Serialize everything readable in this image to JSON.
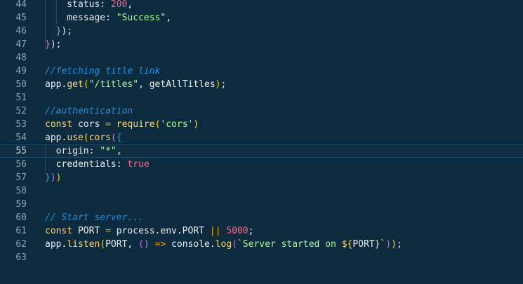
{
  "editor": {
    "lines": [
      {
        "number": "44",
        "tokens": [
          {
            "t": "    status: ",
            "c": "t-plain"
          },
          {
            "t": "200",
            "c": "t-num"
          },
          {
            "t": ",",
            "c": "t-plain"
          }
        ]
      },
      {
        "number": "45",
        "tokens": [
          {
            "t": "    message: ",
            "c": "t-plain"
          },
          {
            "t": "\"Success\"",
            "c": "t-str"
          },
          {
            "t": ",",
            "c": "t-plain"
          }
        ]
      },
      {
        "number": "46",
        "tokens": [
          {
            "t": "  ",
            "c": "t-plain"
          },
          {
            "t": "}",
            "c": "t-b2"
          },
          {
            "t": ");",
            "c": "t-plain"
          }
        ]
      },
      {
        "number": "47",
        "tokens": [
          {
            "t": "}",
            "c": "t-b2"
          },
          {
            "t": ");",
            "c": "t-plain"
          }
        ]
      },
      {
        "number": "48",
        "tokens": []
      },
      {
        "number": "49",
        "tokens": [
          {
            "t": "//fetching title link",
            "c": "t-cmt"
          }
        ]
      },
      {
        "number": "50",
        "tokens": [
          {
            "t": "app.",
            "c": "t-plain"
          },
          {
            "t": "get",
            "c": "t-fn"
          },
          {
            "t": "(",
            "c": "t-b1"
          },
          {
            "t": "\"/titles\"",
            "c": "t-str"
          },
          {
            "t": ", getAllTitles",
            "c": "t-plain"
          },
          {
            "t": ")",
            "c": "t-b1"
          },
          {
            "t": ";",
            "c": "t-plain"
          }
        ]
      },
      {
        "number": "51",
        "tokens": []
      },
      {
        "number": "52",
        "tokens": [
          {
            "t": "//authentication",
            "c": "t-cmt"
          }
        ]
      },
      {
        "number": "53",
        "tokens": [
          {
            "t": "const",
            "c": "t-kw"
          },
          {
            "t": " cors ",
            "c": "t-plain"
          },
          {
            "t": "=",
            "c": "t-op"
          },
          {
            "t": " ",
            "c": "t-plain"
          },
          {
            "t": "require",
            "c": "t-fn"
          },
          {
            "t": "(",
            "c": "t-b1"
          },
          {
            "t": "'cors'",
            "c": "t-str"
          },
          {
            "t": ")",
            "c": "t-b1"
          }
        ]
      },
      {
        "number": "54",
        "tokens": [
          {
            "t": "app.",
            "c": "t-plain"
          },
          {
            "t": "use",
            "c": "t-fn"
          },
          {
            "t": "(",
            "c": "t-b1"
          },
          {
            "t": "cors",
            "c": "t-fn"
          },
          {
            "t": "(",
            "c": "t-b2"
          },
          {
            "t": "{",
            "c": "t-b3"
          }
        ]
      },
      {
        "number": "55",
        "tokens": [
          {
            "t": "  origin: ",
            "c": "t-plain"
          },
          {
            "t": "\"*\"",
            "c": "t-str"
          },
          {
            "t": ",",
            "c": "t-plain"
          }
        ]
      },
      {
        "number": "56",
        "tokens": [
          {
            "t": "  credentials: ",
            "c": "t-plain"
          },
          {
            "t": "true",
            "c": "t-num"
          }
        ]
      },
      {
        "number": "57",
        "tokens": [
          {
            "t": "}",
            "c": "t-b3"
          },
          {
            "t": ")",
            "c": "t-b2"
          },
          {
            "t": ")",
            "c": "t-b1"
          }
        ]
      },
      {
        "number": "58",
        "tokens": []
      },
      {
        "number": "59",
        "tokens": []
      },
      {
        "number": "60",
        "tokens": [
          {
            "t": "// Start server...",
            "c": "t-cmt"
          }
        ]
      },
      {
        "number": "61",
        "tokens": [
          {
            "t": "const",
            "c": "t-kw"
          },
          {
            "t": " PORT ",
            "c": "t-plain"
          },
          {
            "t": "=",
            "c": "t-op"
          },
          {
            "t": " process.env.PORT ",
            "c": "t-plain"
          },
          {
            "t": "||",
            "c": "t-op"
          },
          {
            "t": " ",
            "c": "t-plain"
          },
          {
            "t": "5000",
            "c": "t-num"
          },
          {
            "t": ";",
            "c": "t-plain"
          }
        ]
      },
      {
        "number": "62",
        "tokens": [
          {
            "t": "app.",
            "c": "t-plain"
          },
          {
            "t": "listen",
            "c": "t-fn"
          },
          {
            "t": "(",
            "c": "t-b1"
          },
          {
            "t": "PORT, ",
            "c": "t-plain"
          },
          {
            "t": "()",
            "c": "t-b2"
          },
          {
            "t": " ",
            "c": "t-plain"
          },
          {
            "t": "=>",
            "c": "t-op"
          },
          {
            "t": " console.",
            "c": "t-plain"
          },
          {
            "t": "log",
            "c": "t-fn"
          },
          {
            "t": "(",
            "c": "t-b2"
          },
          {
            "t": "`Server started on ",
            "c": "t-str"
          },
          {
            "t": "${",
            "c": "t-kw"
          },
          {
            "t": "PORT",
            "c": "t-plain"
          },
          {
            "t": "}",
            "c": "t-kw"
          },
          {
            "t": "`",
            "c": "t-str"
          },
          {
            "t": ")",
            "c": "t-b2"
          },
          {
            "t": ")",
            "c": "t-b1"
          },
          {
            "t": ";",
            "c": "t-plain"
          }
        ]
      },
      {
        "number": "63",
        "tokens": []
      }
    ],
    "active_line": "55",
    "colors": {
      "background": "#0d2b3e",
      "line_number": "#8fa3b3",
      "comment": "#1f8fe0",
      "string": "#a5ff90",
      "number": "#ff628c",
      "keyword": "#ffd76e",
      "active_line_border": "#1f4a66"
    }
  }
}
